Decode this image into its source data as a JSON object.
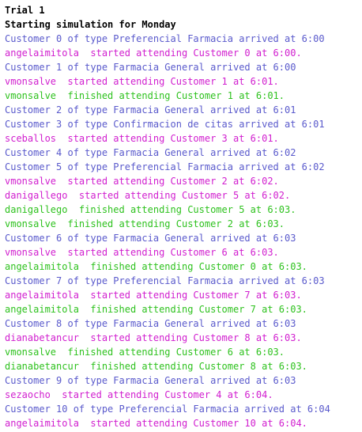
{
  "colors": {
    "header": "#000000",
    "arrival": "#5a5acc",
    "started": "#d11ecf",
    "finished": "#2ec21e"
  },
  "console": {
    "lines": [
      {
        "text": "Trial 1",
        "kind": "header"
      },
      {
        "text": "Starting simulation for Monday",
        "kind": "header"
      },
      {
        "text": "Customer 0 of type Preferencial Farmacia arrived at 6:00",
        "kind": "arrival"
      },
      {
        "text": "angelaimitola  started attending Customer 0 at 6:00.",
        "kind": "started"
      },
      {
        "text": "Customer 1 of type Farmacia General arrived at 6:00",
        "kind": "arrival"
      },
      {
        "text": "vmonsalve  started attending Customer 1 at 6:01.",
        "kind": "started"
      },
      {
        "text": "vmonsalve  finished attending Customer 1 at 6:01.",
        "kind": "finished"
      },
      {
        "text": "Customer 2 of type Farmacia General arrived at 6:01",
        "kind": "arrival"
      },
      {
        "text": "Customer 3 of type Confirmacion de citas arrived at 6:01",
        "kind": "arrival"
      },
      {
        "text": "sceballos  started attending Customer 3 at 6:01.",
        "kind": "started"
      },
      {
        "text": "Customer 4 of type Farmacia General arrived at 6:02",
        "kind": "arrival"
      },
      {
        "text": "Customer 5 of type Preferencial Farmacia arrived at 6:02",
        "kind": "arrival"
      },
      {
        "text": "vmonsalve  started attending Customer 2 at 6:02.",
        "kind": "started"
      },
      {
        "text": "danigallego  started attending Customer 5 at 6:02.",
        "kind": "started"
      },
      {
        "text": "danigallego  finished attending Customer 5 at 6:03.",
        "kind": "finished"
      },
      {
        "text": "vmonsalve  finished attending Customer 2 at 6:03.",
        "kind": "finished"
      },
      {
        "text": "Customer 6 of type Farmacia General arrived at 6:03",
        "kind": "arrival"
      },
      {
        "text": "vmonsalve  started attending Customer 6 at 6:03.",
        "kind": "started"
      },
      {
        "text": "angelaimitola  finished attending Customer 0 at 6:03.",
        "kind": "finished"
      },
      {
        "text": "Customer 7 of type Preferencial Farmacia arrived at 6:03",
        "kind": "arrival"
      },
      {
        "text": "angelaimitola  started attending Customer 7 at 6:03.",
        "kind": "started"
      },
      {
        "text": "angelaimitola  finished attending Customer 7 at 6:03.",
        "kind": "finished"
      },
      {
        "text": "Customer 8 of type Farmacia General arrived at 6:03",
        "kind": "arrival"
      },
      {
        "text": "dianabetancur  started attending Customer 8 at 6:03.",
        "kind": "started"
      },
      {
        "text": "vmonsalve  finished attending Customer 6 at 6:03.",
        "kind": "finished"
      },
      {
        "text": "dianabetancur  finished attending Customer 8 at 6:03.",
        "kind": "finished"
      },
      {
        "text": "Customer 9 of type Farmacia General arrived at 6:03",
        "kind": "arrival"
      },
      {
        "text": "sezaocho  started attending Customer 4 at 6:04.",
        "kind": "started"
      },
      {
        "text": "Customer 10 of type Preferencial Farmacia arrived at 6:04",
        "kind": "arrival"
      },
      {
        "text": "angelaimitola  started attending Customer 10 at 6:04.",
        "kind": "started"
      }
    ]
  }
}
